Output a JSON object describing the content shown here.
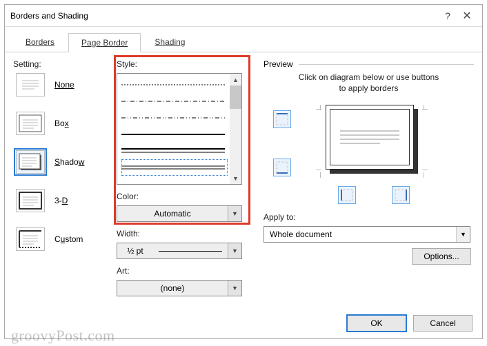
{
  "window": {
    "title": "Borders and Shading",
    "help": "?",
    "close": "✕"
  },
  "tabs": {
    "borders": "Borders",
    "page_border": "Page Border",
    "shading": "Shading"
  },
  "setting": {
    "label": "Setting:",
    "none": "None",
    "box": "Box",
    "shadow": "Shadow",
    "three_d": "3-D",
    "custom": "Custom"
  },
  "style": {
    "label": "Style:",
    "color_label": "Color:",
    "color_value": "Automatic",
    "width_label": "Width:",
    "width_value": "½ pt",
    "art_label": "Art:",
    "art_value": "(none)"
  },
  "preview": {
    "label": "Preview",
    "hint_line1": "Click on diagram below or use buttons",
    "hint_line2": "to apply borders",
    "apply_label": "Apply to:",
    "apply_value": "Whole document",
    "options": "Options..."
  },
  "footer": {
    "ok": "OK",
    "cancel": "Cancel"
  },
  "watermark": "groovyPost.com"
}
